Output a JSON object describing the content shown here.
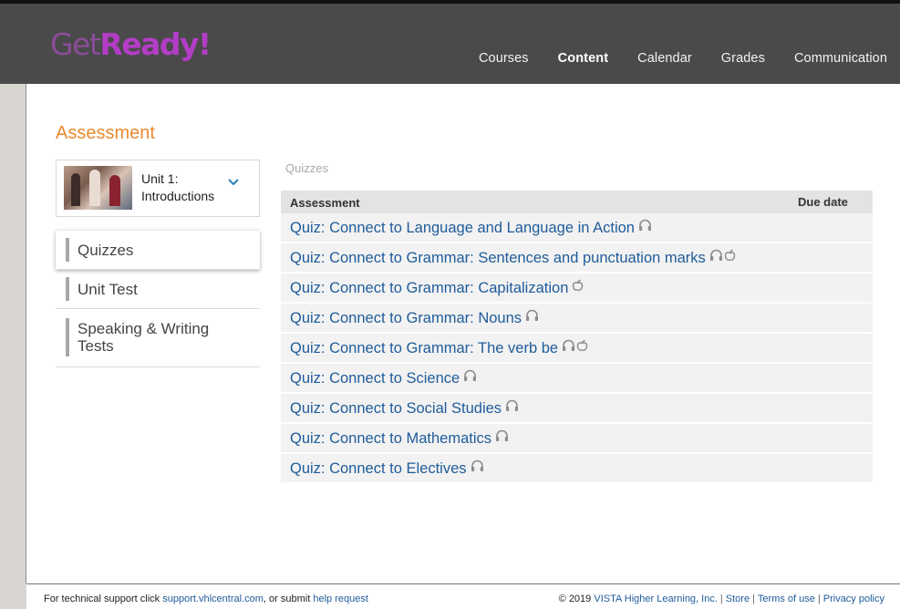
{
  "header": {
    "logo_part1": "Get",
    "logo_part2": "Ready!",
    "nav": [
      {
        "label": "Courses",
        "active": false
      },
      {
        "label": "Content",
        "active": true
      },
      {
        "label": "Calendar",
        "active": false
      },
      {
        "label": "Grades",
        "active": false
      },
      {
        "label": "Communication",
        "active": false
      }
    ]
  },
  "page": {
    "title": "Assessment",
    "unit": {
      "line1": "Unit 1:",
      "line2": "Introductions"
    },
    "side_menu": [
      {
        "label_line1": "Quizzes",
        "label_line2": "",
        "active": true
      },
      {
        "label_line1": "Unit Test",
        "label_line2": "",
        "active": false
      },
      {
        "label_line1": "Speaking & Writing",
        "label_line2": "Tests",
        "active": false
      }
    ],
    "section_label": "Quizzes",
    "table": {
      "col_assessment": "Assessment",
      "col_due": "Due date",
      "rows": [
        {
          "title": "Quiz: Connect to Language and Language in Action",
          "icons": [
            "headphones-icon"
          ]
        },
        {
          "title": "Quiz: Connect to Grammar: Sentences and punctuation marks",
          "icons": [
            "headphones-icon",
            "apple-icon"
          ]
        },
        {
          "title": "Quiz: Connect to Grammar: Capitalization",
          "icons": [
            "apple-icon"
          ]
        },
        {
          "title": "Quiz: Connect to Grammar: Nouns",
          "icons": [
            "headphones-icon"
          ]
        },
        {
          "title": "Quiz: Connect to Grammar: The verb be",
          "icons": [
            "headphones-icon",
            "apple-icon"
          ]
        },
        {
          "title": "Quiz: Connect to Science",
          "icons": [
            "headphones-icon"
          ]
        },
        {
          "title": "Quiz: Connect to Social Studies",
          "icons": [
            "headphones-icon"
          ]
        },
        {
          "title": "Quiz: Connect to Mathematics",
          "icons": [
            "headphones-icon"
          ]
        },
        {
          "title": "Quiz: Connect to Electives",
          "icons": [
            "headphones-icon"
          ]
        }
      ]
    }
  },
  "footer": {
    "support_prefix": "For technical support click",
    "support_link": "support.vhlcentral.com",
    "support_mid": ", or submit",
    "help_link": "help request",
    "copyright": "© 2019",
    "company_link": "VISTA Higher Learning, Inc.",
    "store_link": "Store",
    "terms_link": "Terms of use",
    "privacy_link": "Privacy policy"
  },
  "colors": {
    "header_bg": "#4a4a4a",
    "accent_orange": "#ea8a2e",
    "link_blue": "#1f5c9a",
    "logo_purple": "#b33dc6"
  }
}
